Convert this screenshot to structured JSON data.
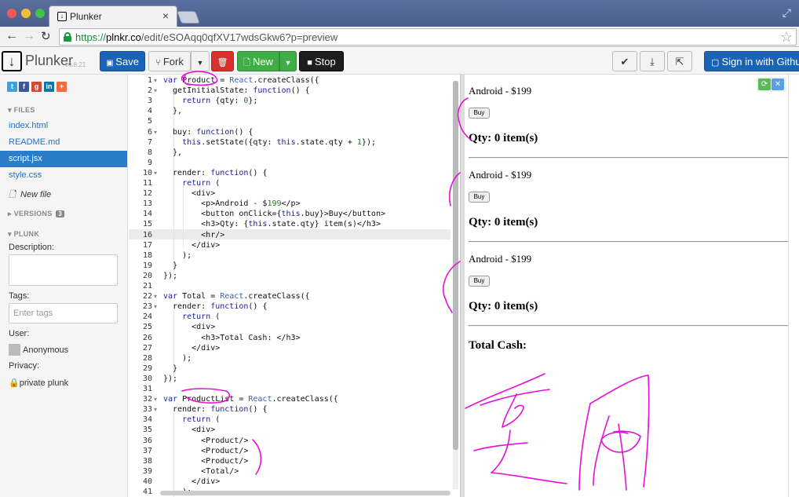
{
  "browser": {
    "tab_title": "Plunker",
    "close_glyph": "×",
    "url_scheme": "https://",
    "url_host": "plnkr.co",
    "url_path": "/edit/eSOAqq0qfXV17wdsGkw6?p=preview"
  },
  "toolbar": {
    "brand": "Plunker",
    "version": "v0.8.21",
    "save_label": "Save",
    "fork_label": "Fork",
    "new_label": "New",
    "stop_label": "Stop",
    "signin_label": "Sign in with Github"
  },
  "sidebar": {
    "social_icons": [
      "twitter-icon",
      "facebook-icon",
      "google-plus-icon",
      "linkedin-icon",
      "add-icon"
    ],
    "files_header": "FILES",
    "files": [
      {
        "name": "index.html",
        "active": false
      },
      {
        "name": "README.md",
        "active": false
      },
      {
        "name": "script.jsx",
        "active": true
      },
      {
        "name": "style.css",
        "active": false
      }
    ],
    "new_file_label": "New file",
    "versions_header": "VERSIONS",
    "versions_count": "3",
    "plunk_header": "PLUNK",
    "description_label": "Description:",
    "tags_label": "Tags:",
    "tags_placeholder": "Enter tags",
    "user_label": "User:",
    "user_name": "Anonymous",
    "privacy_label": "Privacy:",
    "privacy_value": "private plunk"
  },
  "editor": {
    "active_line": 16,
    "lines": [
      "var Product = React.createClass({",
      "  getInitialState: function() {",
      "    return {qty: 0};",
      "  },",
      "",
      "  buy: function() {",
      "    this.setState({qty: this.state.qty + 1});",
      "  },",
      "",
      "  render: function() {",
      "    return (",
      "      <div>",
      "        <p>Android - $199</p>",
      "        <button onClick={this.buy}>Buy</button>",
      "        <h3>Qty: {this.state.qty} item(s)</h3>",
      "        <hr/>",
      "      </div>",
      "    );",
      "  }",
      "});",
      "",
      "var Total = React.createClass({",
      "  render: function() {",
      "    return (",
      "      <div>",
      "        <h3>Total Cash: </h3>",
      "      </div>",
      "    );",
      "  }",
      "});",
      "",
      "var ProductList = React.createClass({",
      "  render: function() {",
      "    return (",
      "      <div>",
      "        <Product/>",
      "        <Product/>",
      "        <Product/>",
      "        <Total/>",
      "      </div>",
      "    );"
    ],
    "fold_lines": [
      1,
      2,
      6,
      10,
      22,
      23,
      32,
      33
    ]
  },
  "preview": {
    "products": [
      {
        "text": "Android - $199",
        "button": "Buy",
        "qty": "Qty: 0 item(s)"
      },
      {
        "text": "Android - $199",
        "button": "Buy",
        "qty": "Qty: 0 item(s)"
      },
      {
        "text": "Android - $199",
        "button": "Buy",
        "qty": "Qty: 0 item(s)"
      }
    ],
    "total_label": "Total Cash:"
  },
  "colors": {
    "save": "#1a63b5",
    "delete": "#d9302c",
    "new": "#3fae46",
    "stop": "#1d1d1d",
    "active_file": "#2a7dc9",
    "annotation": "#e60fd8"
  }
}
